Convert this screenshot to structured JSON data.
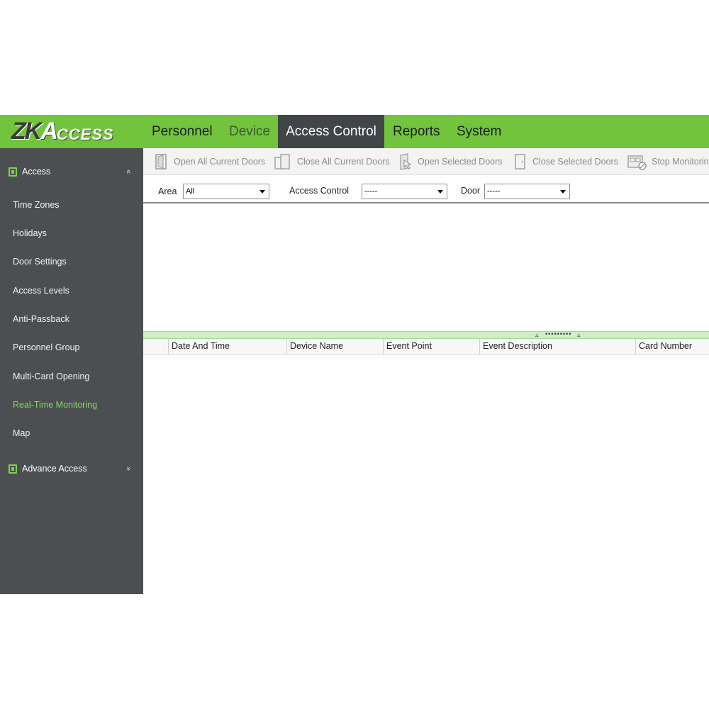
{
  "logo": {
    "text_zk": "ZK",
    "text_a": "A",
    "text_rest": "CCESS"
  },
  "nav": [
    {
      "label": "Personnel"
    },
    {
      "label": "Device"
    },
    {
      "label": "Access Control"
    },
    {
      "label": "Reports"
    },
    {
      "label": "System"
    }
  ],
  "sidebar": {
    "section_access": {
      "label": "Access",
      "chevron": "«"
    },
    "items": [
      {
        "label": "Time Zones"
      },
      {
        "label": "Holidays"
      },
      {
        "label": "Door Settings"
      },
      {
        "label": "Access Levels"
      },
      {
        "label": "Anti-Passback"
      },
      {
        "label": "Personnel Group"
      },
      {
        "label": "Multi-Card Opening"
      },
      {
        "label": "Real-Time Monitoring"
      },
      {
        "label": "Map"
      }
    ],
    "section_advance": {
      "label": "Advance Access",
      "chevron": "»"
    }
  },
  "toolbar": {
    "open_all": "Open All Current Doors",
    "close_all": "Close All Current Doors",
    "open_selected": "Open Selected Doors",
    "close_selected": "Close Selected Doors",
    "stop_monitoring": "Stop Monitoring"
  },
  "filters": {
    "area_label": "Area",
    "area_value": "All",
    "access_control_label": "Access Control",
    "access_control_value": "-----",
    "door_label": "Door",
    "door_value": "-----"
  },
  "splitter": {
    "left": "▵",
    "dots": "•••••••••",
    "right": "▵"
  },
  "events": {
    "columns": [
      {
        "label": "Date And Time"
      },
      {
        "label": "Device Name"
      },
      {
        "label": "Event Point"
      },
      {
        "label": "Event Description"
      },
      {
        "label": "Card Number"
      }
    ]
  },
  "colors": {
    "brand_green": "#72c43c",
    "sidebar_bg": "#4b4f51",
    "active_tab_bg": "#404547",
    "current_item": "#84d957"
  }
}
